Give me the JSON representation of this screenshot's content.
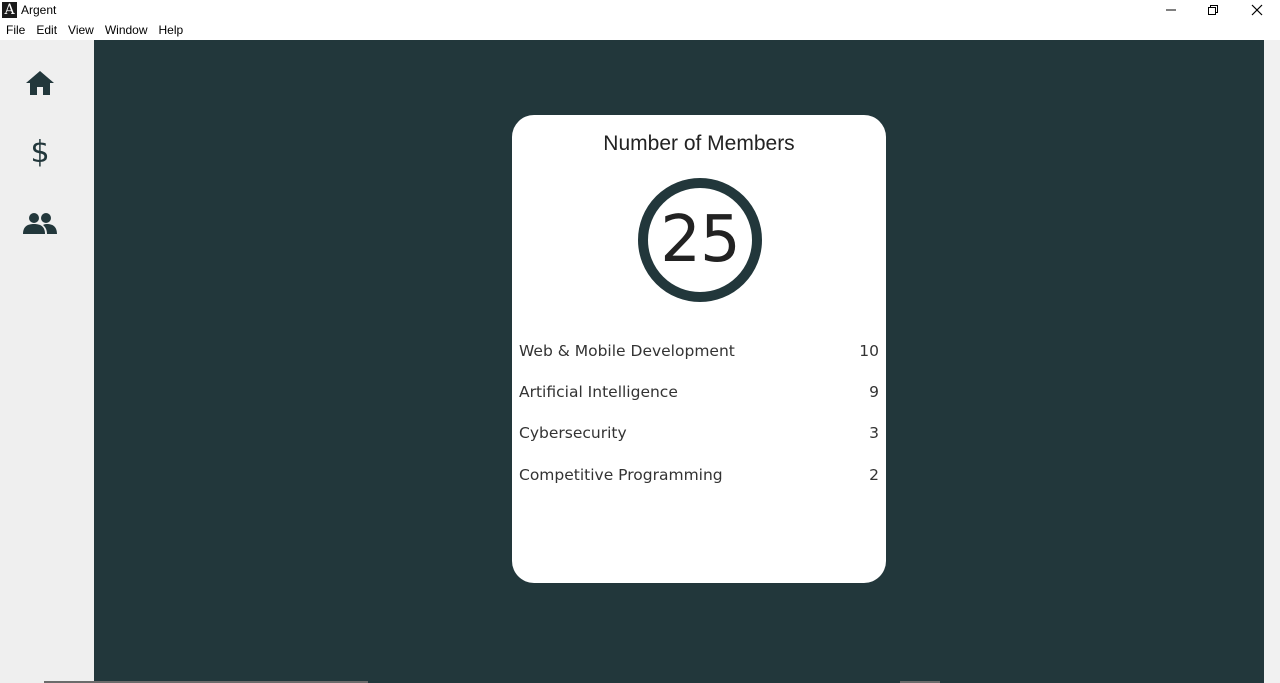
{
  "window": {
    "title": "Argent",
    "logo_letter": "A",
    "controls": [
      "minimize-icon",
      "restore-icon",
      "close-icon"
    ]
  },
  "menu": {
    "items": [
      "File",
      "Edit",
      "View",
      "Window",
      "Help"
    ]
  },
  "sidebar": {
    "items": [
      {
        "icon": "home-icon"
      },
      {
        "icon": "dollar-icon",
        "glyph": "$"
      },
      {
        "icon": "people-icon"
      }
    ]
  },
  "colors": {
    "main_bg": "#22373b",
    "sidebar_bg": "#efefef",
    "card_bg": "#ffffff",
    "accent": "#22373b"
  },
  "card": {
    "title": "Number of Members",
    "total": "25",
    "categories": [
      {
        "name": "Web & Mobile Development",
        "count": "10"
      },
      {
        "name": "Artificial Intelligence",
        "count": "9"
      },
      {
        "name": "Cybersecurity",
        "count": "3"
      },
      {
        "name": "Competitive Programming",
        "count": "2"
      }
    ]
  }
}
